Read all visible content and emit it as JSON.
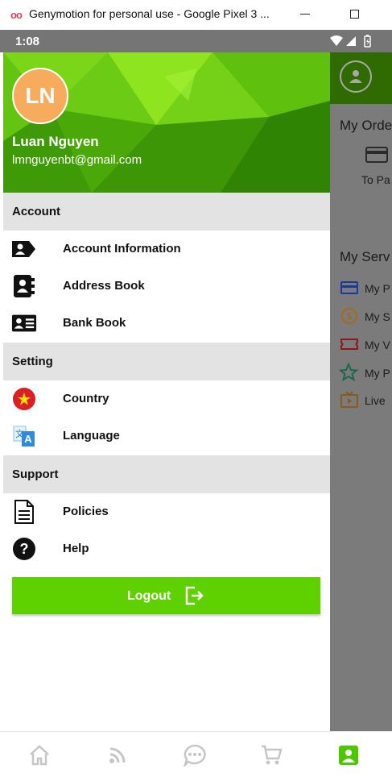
{
  "window": {
    "logo_text": "oo",
    "title": "Genymotion for personal use - Google Pixel 3 ..."
  },
  "statusbar": {
    "time": "1:08"
  },
  "drawer": {
    "avatar_initials": "LN",
    "user_name": "Luan Nguyen",
    "user_email": "lmnguyenbt@gmail.com",
    "sections": {
      "account": "Account",
      "setting": "Setting",
      "support": "Support"
    },
    "items": {
      "account_information": "Account Information",
      "address_book": "Address Book",
      "bank_book": "Bank Book",
      "country": "Country",
      "language": "Language",
      "policies": "Policies",
      "help": "Help"
    },
    "logout_label": "Logout"
  },
  "background_app": {
    "my_orders": "My Orde",
    "to_pay": "To Pa",
    "my_services": "My Serv",
    "service_items": [
      "My P",
      "My S",
      "My V",
      "My P",
      "Live"
    ]
  },
  "colors": {
    "accent_green": "#5fd000",
    "avatar_orange": "#f7ab5c",
    "section_grey": "#e3e3e3"
  },
  "icons": {
    "bottom_nav": [
      "home-icon",
      "feed-icon",
      "chat-icon",
      "cart-icon",
      "profile-icon"
    ]
  }
}
